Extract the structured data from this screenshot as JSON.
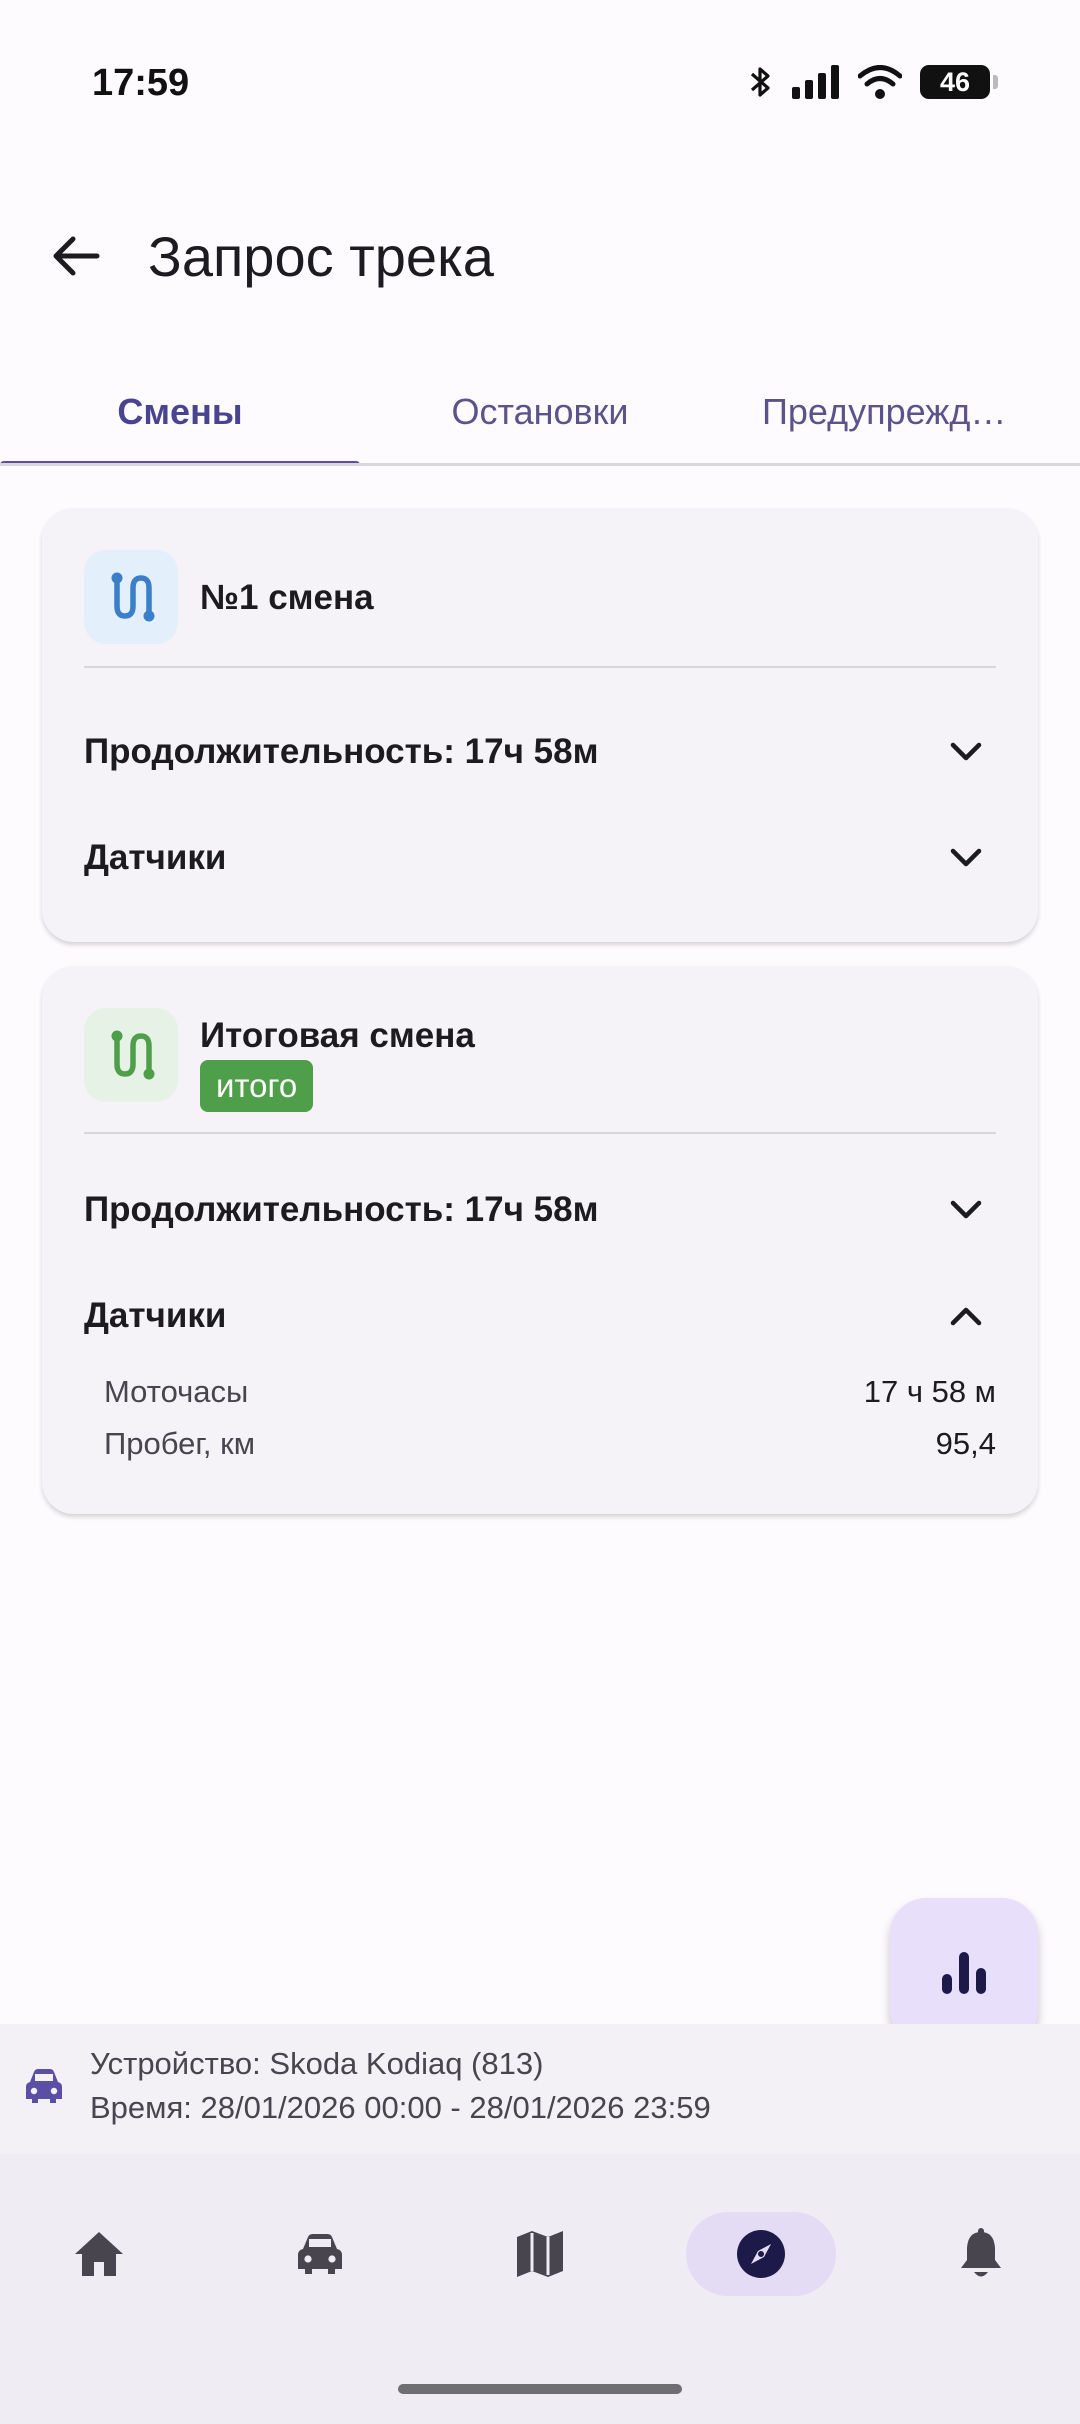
{
  "status_bar": {
    "time": "17:59",
    "battery": "46"
  },
  "header": {
    "title": "Запрос трека"
  },
  "tabs": [
    {
      "label": "Смены"
    },
    {
      "label": "Остановки"
    },
    {
      "label": "Предупреждения"
    }
  ],
  "cards": [
    {
      "title": "№1 смена",
      "duration_label": "Продолжительность: 17ч 58м",
      "sensors_label": "Датчики"
    },
    {
      "title": "Итоговая смена",
      "badge": "итого",
      "duration_label": "Продолжительность: 17ч 58м",
      "sensors_label": "Датчики",
      "sensors": [
        {
          "label": "Моточасы",
          "value": "17 ч 58 м"
        },
        {
          "label": "Пробег, км",
          "value": "95,4"
        }
      ]
    }
  ],
  "info": {
    "device": "Устройство: Skoda Kodiaq (813)",
    "time": "Время: 28/01/2026 00:00 - 28/01/2026 23:59"
  },
  "colors": {
    "accent": "#5a4fa5",
    "badge_green": "#4f9f4a",
    "route_icon_blue": "#3a7fc8",
    "route_icon_green": "#4f9f4a"
  },
  "icons": {
    "back": "arrow-left-icon",
    "route": "route-icon",
    "chevron_down": "chevron-down-icon",
    "chevron_up": "chevron-up-icon",
    "fab": "bar-chart-icon",
    "car": "car-icon",
    "nav": [
      "home-icon",
      "car-icon",
      "map-icon",
      "compass-icon",
      "bell-icon"
    ]
  }
}
